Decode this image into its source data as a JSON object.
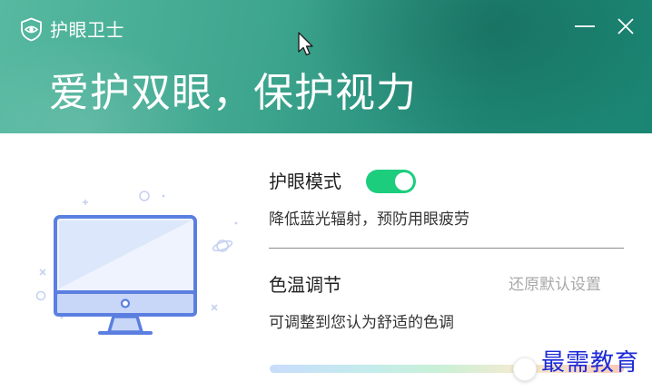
{
  "app": {
    "title": "护眼卫士",
    "slogan": "爱护双眼，保护视力"
  },
  "window_controls": {
    "minimize_icon": "minimize-icon",
    "close_icon": "close-icon"
  },
  "eye_mode": {
    "label": "护眼模式",
    "enabled": true,
    "description": "降低蓝光辐射，预防用眼疲劳"
  },
  "color_temp": {
    "label": "色温调节",
    "reset_label": "还原默认设置",
    "description": "可调整到您认为舒适的色调",
    "value_fraction": 0.72
  },
  "watermark": "最需教育",
  "colors": {
    "header_start": "#56b9a0",
    "header_end": "#1b8573",
    "toggle_on": "#1ccd7e",
    "monitor_blue": "#5b7fe0",
    "watermark_blue": "#1d2bd6"
  }
}
